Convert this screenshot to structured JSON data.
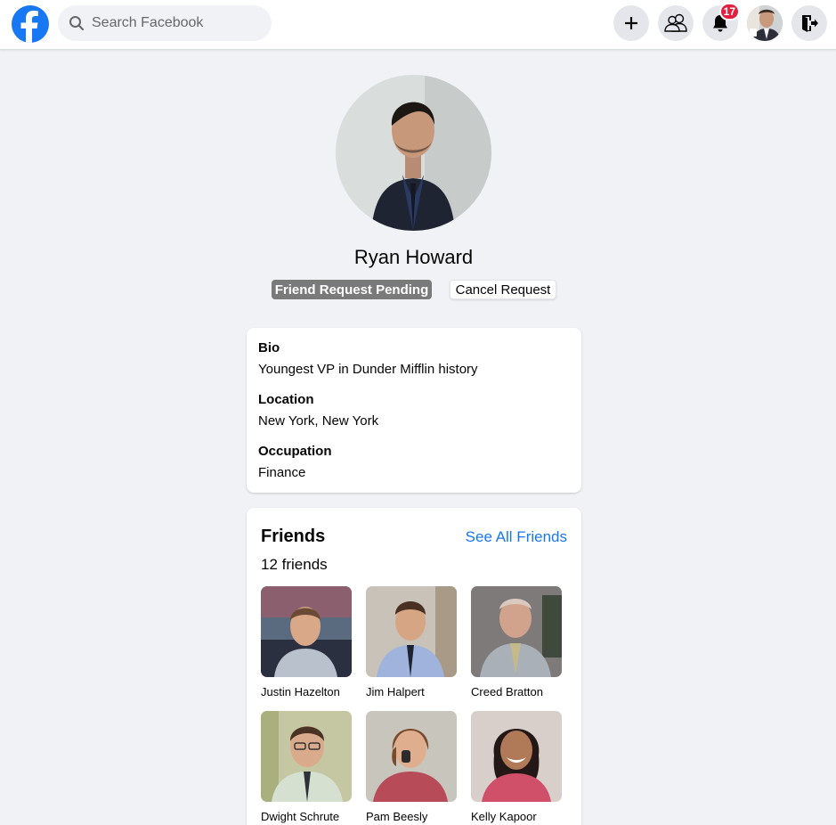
{
  "search": {
    "placeholder": "Search Facebook"
  },
  "header": {
    "notification_count": "17",
    "accent_color": "#1877f2",
    "badge_color": "#e41e3f"
  },
  "profile": {
    "name": "Ryan Howard",
    "pending_label": "Friend Request Pending",
    "cancel_label": "Cancel Request"
  },
  "about": {
    "bio_label": "Bio",
    "bio_value": "Youngest VP in Dunder Mifflin history",
    "location_label": "Location",
    "location_value": "New York, New York",
    "occupation_label": "Occupation",
    "occupation_value": "Finance"
  },
  "friends": {
    "title": "Friends",
    "see_all": "See All Friends",
    "count": "12 friends",
    "items": [
      {
        "name": "Justin Hazelton"
      },
      {
        "name": "Jim Halpert"
      },
      {
        "name": "Creed Bratton"
      },
      {
        "name": "Dwight Schrute"
      },
      {
        "name": "Pam Beesly"
      },
      {
        "name": "Kelly Kapoor"
      }
    ]
  }
}
